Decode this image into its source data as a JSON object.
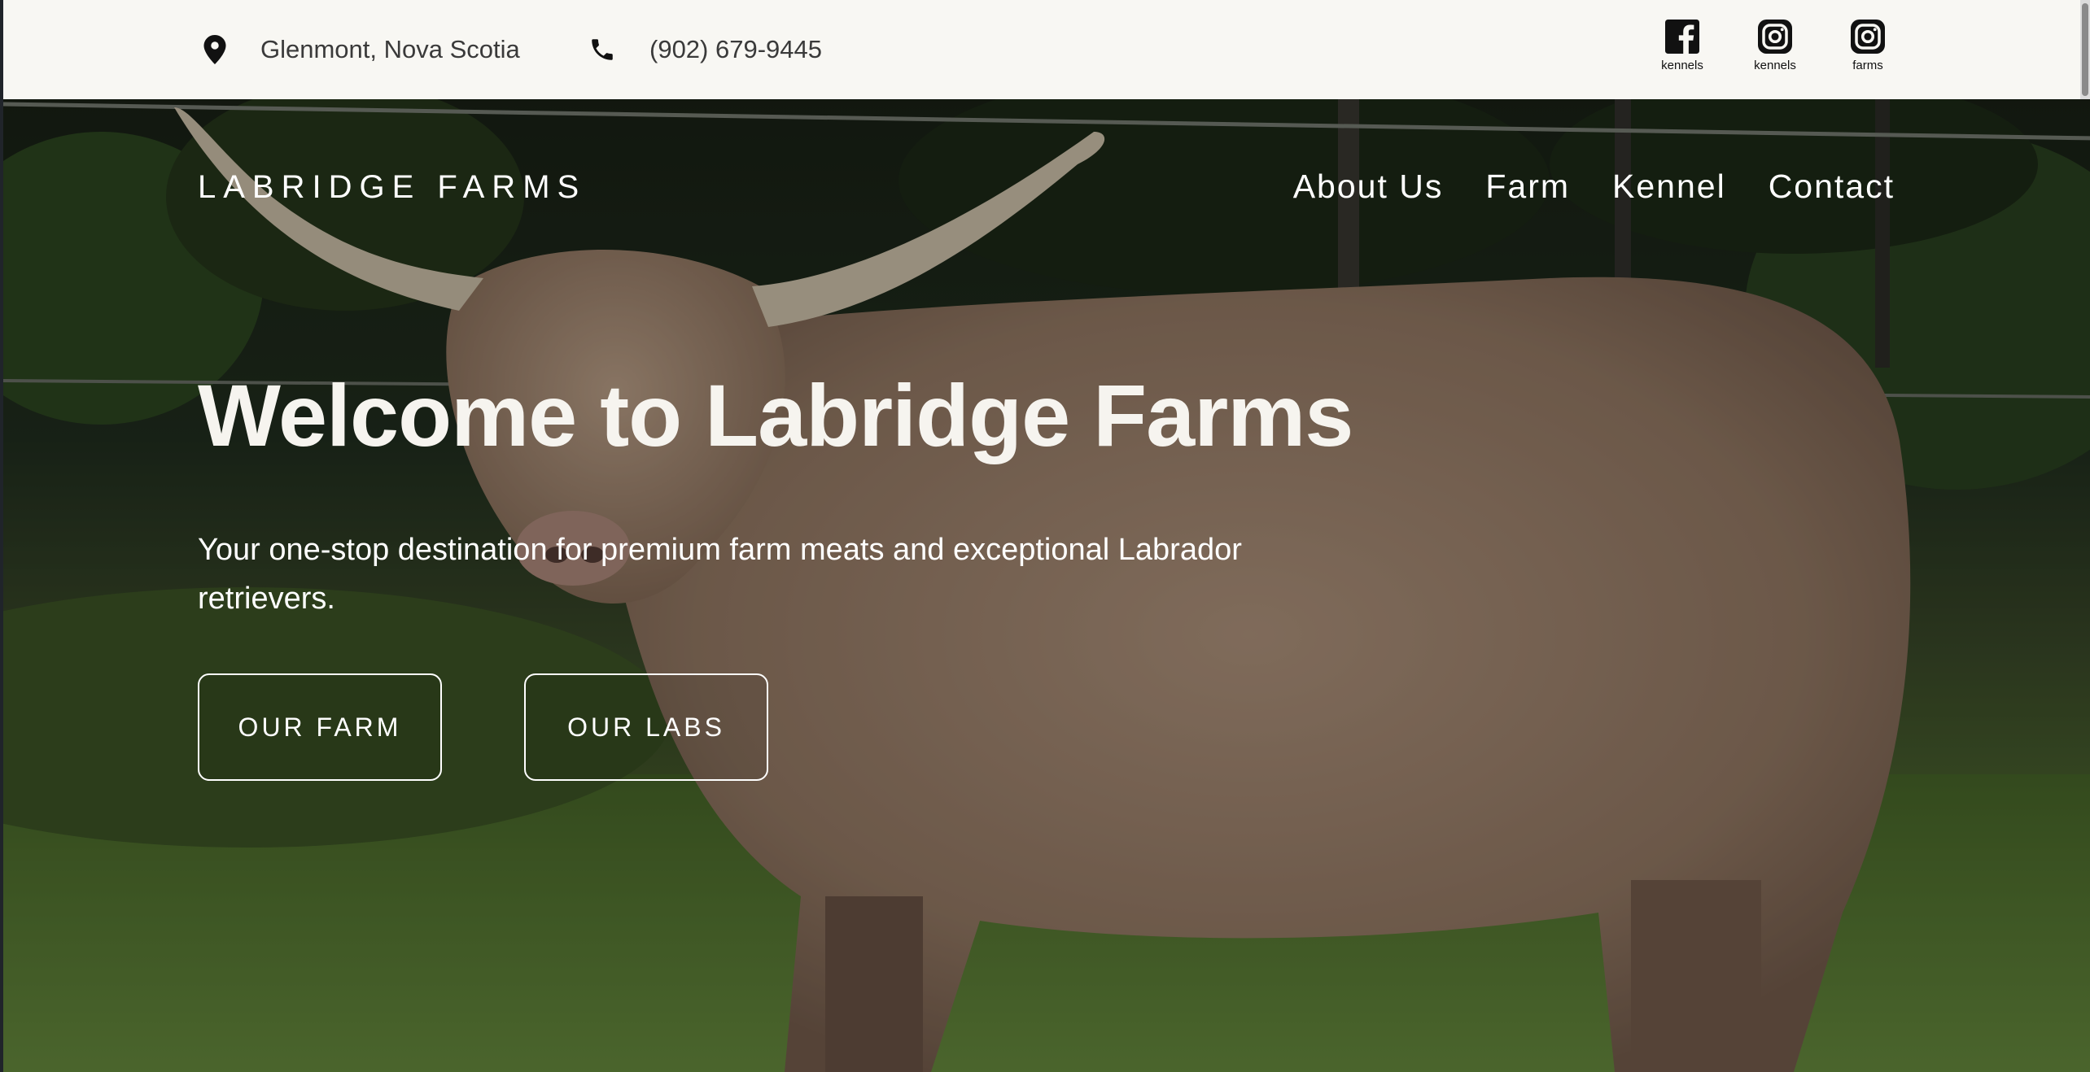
{
  "topbar": {
    "location": {
      "icon": "map-pin-icon",
      "text": "Glenmont, Nova Scotia"
    },
    "phone": {
      "icon": "phone-icon",
      "text": "(902) 679-9445"
    },
    "social": [
      {
        "icon": "facebook-icon",
        "label": "kennels"
      },
      {
        "icon": "instagram-icon",
        "label": "kennels"
      },
      {
        "icon": "instagram-icon",
        "label": "farms"
      }
    ]
  },
  "header": {
    "brand": "LABRIDGE FARMS",
    "nav": [
      "About Us",
      "Farm",
      "Kennel",
      "Contact"
    ]
  },
  "hero": {
    "title": "Welcome to Labridge Farms",
    "subtitle": "Your one-stop destination for premium farm meats and exceptional Labrador retrievers.",
    "buttons": [
      "OUR FARM",
      "OUR LABS"
    ]
  },
  "colors": {
    "topbar_bg": "#f8f7f3",
    "text_light": "#ffffff",
    "text_dark": "#3a3a3a"
  }
}
